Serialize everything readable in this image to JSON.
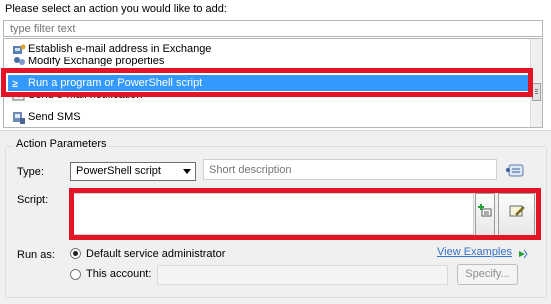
{
  "header": {
    "prompt": "Please select an action you would like to add:"
  },
  "filter": {
    "placeholder": "type filter text"
  },
  "actions": [
    {
      "label": "Establish e-mail address in Exchange",
      "icon": "exchange-user-icon"
    },
    {
      "label": "Modify Exchange properties",
      "icon": "exchange-properties-icon"
    },
    {
      "label": "Run a program or PowerShell script",
      "icon": "powershell-icon",
      "selected": true
    },
    {
      "label": "Send e-mail notification",
      "icon": "email-icon"
    },
    {
      "label": "Send SMS",
      "icon": "sms-icon"
    }
  ],
  "params": {
    "legend": "Action Parameters",
    "type_label": "Type:",
    "type_value": "PowerShell script",
    "description_placeholder": "Short description",
    "script_label": "Script:",
    "script_value": "",
    "runas_label": "Run as:",
    "default_admin": "Default service administrator",
    "this_account": "This account:",
    "view_examples": "View Examples",
    "specify": "Specify..."
  },
  "colors": {
    "selection": "#3399ff",
    "highlight": "#e41325",
    "link": "#3771c8"
  }
}
